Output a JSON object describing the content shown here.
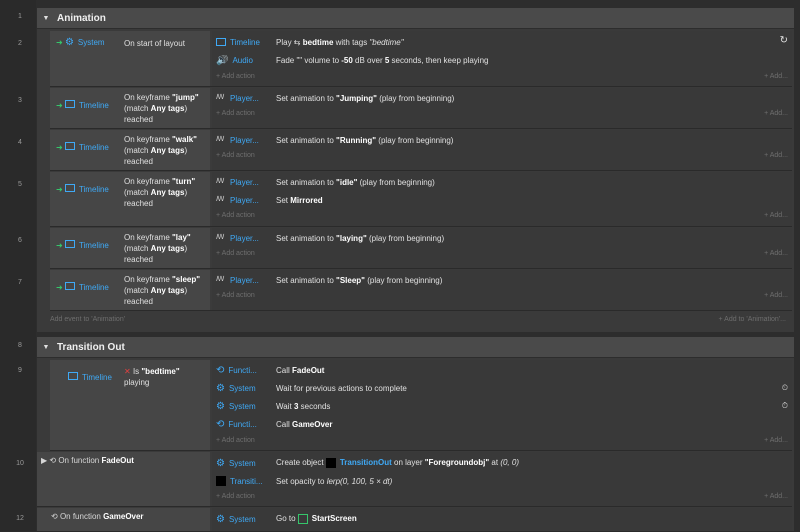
{
  "groups": [
    {
      "line": "1",
      "name": "Animation"
    },
    {
      "line": "8",
      "name": "Transition Out"
    }
  ],
  "events": [
    {
      "line": "2",
      "cond_obj": "System",
      "cond": "On start of layout",
      "actions": [
        {
          "obj": "Timeline",
          "pre": "Play ",
          "bold": "bedtime",
          "post": " with tags ",
          "ital": "\"bedtime\""
        },
        {
          "obj": "Audio",
          "pre": "Fade \"\" volume to ",
          "bold": "-50",
          "post": " dB over ",
          "bold2": "5",
          "post2": " seconds, then keep playing"
        }
      ]
    },
    {
      "line": "3",
      "cond_obj": "Timeline",
      "cond_pre": "On keyframe ",
      "cond_bold": "\"jump\"",
      "cond_post": "(match ",
      "cond_bold2": "Any tags",
      "cond_post2": ") reached",
      "actions": [
        {
          "obj": "Player...",
          "pre": "Set animation to ",
          "bold": "\"Jumping\"",
          "post": " (play from beginning)"
        }
      ]
    },
    {
      "line": "4",
      "cond_obj": "Timeline",
      "cond_pre": "On keyframe ",
      "cond_bold": "\"walk\"",
      "cond_post": "(match ",
      "cond_bold2": "Any tags",
      "cond_post2": ") reached",
      "actions": [
        {
          "obj": "Player...",
          "pre": "Set animation to ",
          "bold": "\"Running\"",
          "post": " (play from beginning)"
        }
      ]
    },
    {
      "line": "5",
      "cond_obj": "Timeline",
      "cond_pre": "On keyframe ",
      "cond_bold": "\"turn\"",
      "cond_post": "(match ",
      "cond_bold2": "Any tags",
      "cond_post2": ") reached",
      "actions": [
        {
          "obj": "Player...",
          "pre": "Set animation to ",
          "bold": "\"idle\"",
          "post": " (play from beginning)"
        },
        {
          "obj": "Player...",
          "pre": "Set ",
          "bold": "Mirrored",
          "post": ""
        }
      ]
    },
    {
      "line": "6",
      "cond_obj": "Timeline",
      "cond_pre": "On keyframe ",
      "cond_bold": "\"lay\"",
      "cond_post": "(match ",
      "cond_bold2": "Any tags",
      "cond_post2": ") reached",
      "actions": [
        {
          "obj": "Player...",
          "pre": "Set animation to ",
          "bold": "\"laying\"",
          "post": " (play from beginning)"
        }
      ]
    },
    {
      "line": "7",
      "cond_obj": "Timeline",
      "cond_pre": "On keyframe ",
      "cond_bold": "\"sleep\"",
      "cond_post": "(match ",
      "cond_bold2": "Any tags",
      "cond_post2": ") reached",
      "actions": [
        {
          "obj": "Player...",
          "pre": "Set animation to ",
          "bold": "\"Sleep\"",
          "post": " (play from beginning)"
        }
      ]
    }
  ],
  "add_action": "+ Add action",
  "add_right": "+ Add...",
  "add_event": "Add event to 'Animation'",
  "add_to_group": "+ Add to 'Animation'...",
  "ev9": {
    "line": "9",
    "obj": "Timeline",
    "is": "Is ",
    "bold": "\"bedtime\"",
    "post": "playing",
    "actions": [
      {
        "obj": "Functi...",
        "pre": "Call ",
        "bold": "FadeOut"
      },
      {
        "obj": "System",
        "pre": "Wait for previous actions to complete",
        "bold": ""
      },
      {
        "obj": "System",
        "pre": "Wait ",
        "bold": "3",
        "post": " seconds"
      },
      {
        "obj": "Functi...",
        "pre": "Call ",
        "bold": "GameOver"
      }
    ]
  },
  "ev10": {
    "line": "10",
    "pre": "On function ",
    "bold": "FadeOut",
    "a1": {
      "obj": "System",
      "pre": "Create object ",
      "link": "TransitionOut",
      "mid": " on layer ",
      "bold": "\"Foregroundobj\"",
      "post": " at ",
      "ital": "(0, 0)"
    },
    "a2": {
      "obj": "Transiti...",
      "pre": "Set opacity to ",
      "ital": "lerp(0, 100, 5 × dt)"
    }
  },
  "ev12": {
    "line": "12",
    "pre": "On function ",
    "bold": "GameOver",
    "a1": {
      "obj": "System",
      "pre": "Go to ",
      "link": "StartScreen"
    }
  }
}
